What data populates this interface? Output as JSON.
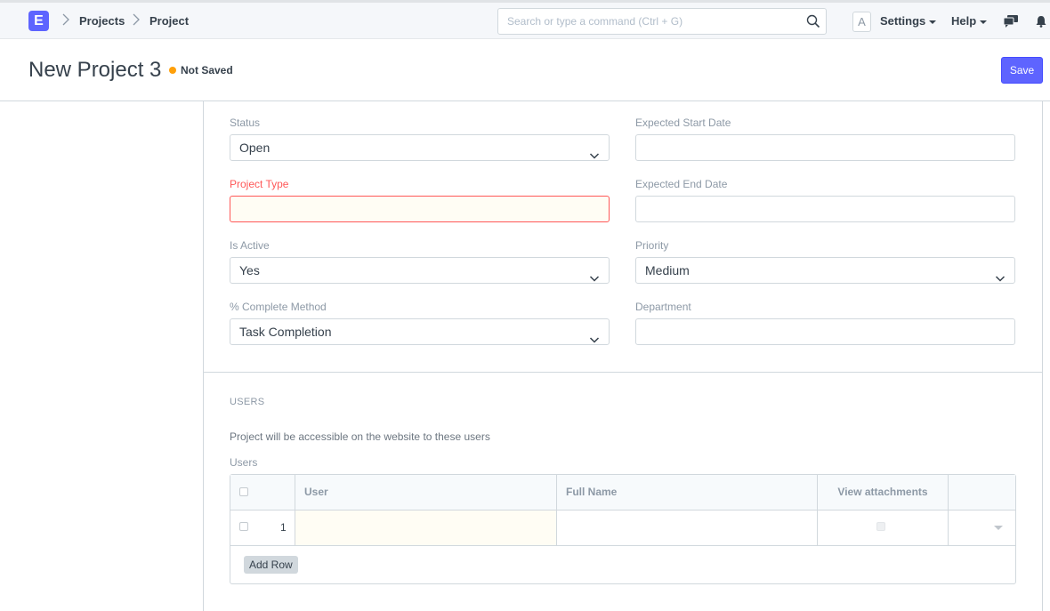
{
  "navbar": {
    "logo_letter": "E",
    "breadcrumbs": [
      "Projects",
      "Project"
    ],
    "search_placeholder": "Search or type a command (Ctrl + G)",
    "avatar_letter": "A",
    "settings_label": "Settings",
    "help_label": "Help",
    "icons": [
      "search-icon",
      "chat-icon",
      "bell-icon"
    ]
  },
  "page": {
    "title": "New Project 3",
    "status": "Not Saved",
    "status_color": "#ffa00a",
    "save_label": "Save",
    "accent_color": "#5e64ff"
  },
  "form": {
    "status": {
      "label": "Status",
      "value": "Open"
    },
    "project_type": {
      "label": "Project Type",
      "value": ""
    },
    "is_active": {
      "label": "Is Active",
      "value": "Yes"
    },
    "complete_method": {
      "label": "% Complete Method",
      "value": "Task Completion"
    },
    "expected_start_date": {
      "label": "Expected Start Date",
      "value": ""
    },
    "expected_end_date": {
      "label": "Expected End Date",
      "value": ""
    },
    "priority": {
      "label": "Priority",
      "value": "Medium"
    },
    "department": {
      "label": "Department",
      "value": ""
    }
  },
  "users_section": {
    "title": "USERS",
    "description": "Project will be accessible on the website to these users",
    "table_label": "Users",
    "columns": [
      "User",
      "Full Name",
      "View attachments"
    ],
    "rows": [
      {
        "idx": "1",
        "user": "",
        "full_name": ""
      }
    ],
    "add_row_label": "Add Row"
  }
}
